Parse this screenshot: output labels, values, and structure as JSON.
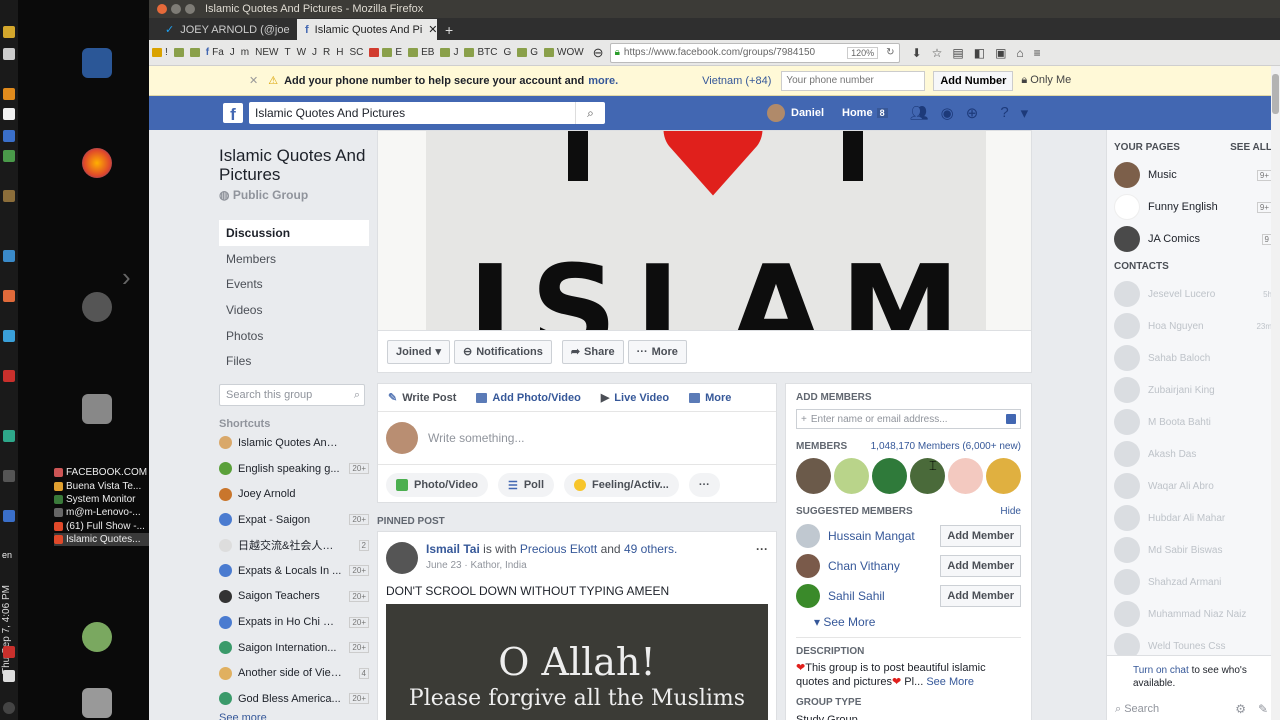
{
  "window": {
    "title": "Islamic Quotes And Pictures - Mozilla Firefox"
  },
  "tabs": [
    {
      "label": "JOEY ARNOLD (@joe"
    },
    {
      "label": "Islamic Quotes And Pi"
    }
  ],
  "bookmarks": [
    "!",
    "Fa",
    "J",
    "m",
    "NEW",
    "T",
    "W",
    "J",
    "R",
    "H",
    "SC",
    "E",
    "EB",
    "J",
    "BTC",
    "G",
    "G",
    "WOW"
  ],
  "url": {
    "value": "https://www.facebook.com/groups/7984150",
    "zoom": "120%"
  },
  "notice": {
    "text": "Add your phone number to help secure your account and",
    "more": "more.",
    "country": "Vietnam (+84)",
    "placeholder": "Your phone number",
    "add_button": "Add Number",
    "privacy": "Only Me"
  },
  "fb": {
    "search_value": "Islamic Quotes And Pictures",
    "user": "Daniel",
    "home": "Home",
    "home_count": "8"
  },
  "group": {
    "name": "Islamic Quotes And Pictures",
    "type": "Public Group",
    "nav": [
      "Discussion",
      "Members",
      "Events",
      "Videos",
      "Photos",
      "Files"
    ],
    "search_placeholder": "Search this group",
    "shortcuts_title": "Shortcuts",
    "shortcuts": [
      {
        "name": "Islamic Quotes And Pict...",
        "badge": ""
      },
      {
        "name": "English speaking g...",
        "badge": "20+"
      },
      {
        "name": "Joey Arnold",
        "badge": ""
      },
      {
        "name": "Expat - Saigon",
        "badge": "20+"
      },
      {
        "name": "日越交流&社会人ボ...",
        "badge": "2"
      },
      {
        "name": "Expats & Locals In ...",
        "badge": "20+"
      },
      {
        "name": "Saigon Teachers",
        "badge": "20+"
      },
      {
        "name": "Expats in Ho Chi Mi...",
        "badge": "20+"
      },
      {
        "name": "Saigon Internation...",
        "badge": "20+"
      },
      {
        "name": "Another side of Vietn...",
        "badge": "4"
      },
      {
        "name": "God Bless America...",
        "badge": "20+"
      }
    ],
    "see_more": "See more"
  },
  "cover": {
    "text": "ISLAM"
  },
  "actions": {
    "joined": "Joined",
    "notifications": "Notifications",
    "share": "Share",
    "more": "More"
  },
  "composer": {
    "tabs": [
      "Write Post",
      "Add Photo/Video",
      "Live Video",
      "More"
    ],
    "placeholder": "Write something...",
    "pills": [
      "Photo/Video",
      "Poll",
      "Feeling/Activ..."
    ]
  },
  "pinned": {
    "label": "PINNED POST",
    "author": "Ismail Tai",
    "with_text": "is with",
    "tagged": "Precious Ekott",
    "and_text": "and",
    "others": "49 others.",
    "meta": "June 23 · Kathor, India",
    "text": "DON'T SCROOL DOWN WITHOUT TYPING AMEEN",
    "img_line1": "O Allah!",
    "img_line2": "Please forgive all the Muslims"
  },
  "right": {
    "add_members": "ADD MEMBERS",
    "add_placeholder": "Enter name or email address...",
    "members": "MEMBERS",
    "members_count": "1,048,170 Members (6,000+ new)",
    "suggested": "SUGGESTED MEMBERS",
    "hide": "Hide",
    "suggestions": [
      "Hussain Mangat",
      "Chan Vithany",
      "Sahil Sahil"
    ],
    "add_member": "Add Member",
    "see_more": "See More",
    "description_title": "DESCRIPTION",
    "description": "This group is to post beautiful islamic quotes and pictures",
    "description_more": "Pl...",
    "see_more2": "See More",
    "group_type_title": "GROUP TYPE",
    "group_type": "Study Group"
  },
  "chat": {
    "your_pages": "YOUR PAGES",
    "see_all": "SEE ALL",
    "pages": [
      {
        "name": "Music",
        "count": "9+"
      },
      {
        "name": "Funny English",
        "count": "9+"
      },
      {
        "name": "JA Comics",
        "count": "9"
      }
    ],
    "contacts": "CONTACTS",
    "people": [
      {
        "name": "Jesevel Lucero",
        "time": "5h"
      },
      {
        "name": "Hoa Nguyen",
        "time": "23m"
      },
      {
        "name": "Sahab Baloch",
        "time": ""
      },
      {
        "name": "Zubairjani King",
        "time": ""
      },
      {
        "name": "M Boota Bahti",
        "time": ""
      },
      {
        "name": "Akash Das",
        "time": ""
      },
      {
        "name": "Waqar Ali Abro",
        "time": ""
      },
      {
        "name": "Hubdar Ali Mahar",
        "time": ""
      },
      {
        "name": "Md Sabir Biswas",
        "time": ""
      },
      {
        "name": "Shahzad Armani",
        "time": ""
      },
      {
        "name": "Muhammad Niaz Naiz",
        "time": ""
      },
      {
        "name": "Weld Tounes Css",
        "time": ""
      }
    ],
    "turn_on": "Turn on chat",
    "turn_on_rest": "to see who's available.",
    "search": "Search"
  },
  "taskbar": [
    "FACEBOOK.COM",
    "Buena Vista Te...",
    "System Monitor",
    "m@m-Lenovo-...",
    "(61) Full Show -...",
    "Islamic Quotes..."
  ],
  "system": {
    "clock": "Thu Sep 7, 4:06 PM",
    "lang": "en"
  }
}
